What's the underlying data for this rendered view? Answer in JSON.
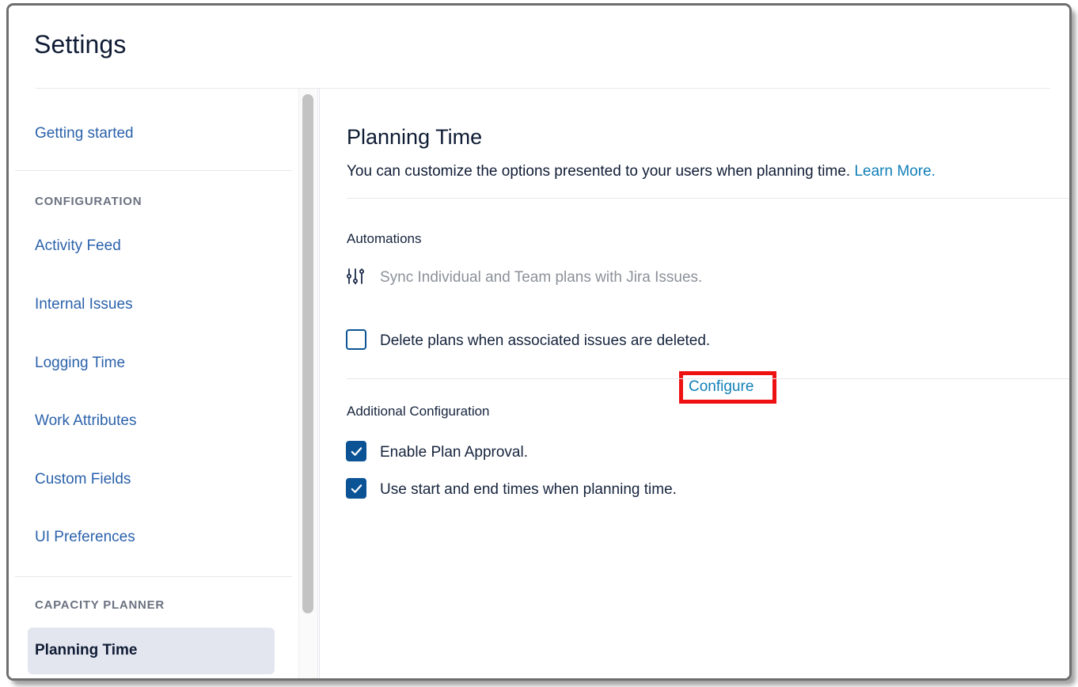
{
  "window": {
    "title": "Settings"
  },
  "sidebar": {
    "top_links": [
      {
        "label": "Getting started",
        "name": "sidebar-item-getting-started"
      }
    ],
    "sections": [
      {
        "heading": "CONFIGURATION",
        "items": [
          {
            "label": "Activity Feed"
          },
          {
            "label": "Internal Issues"
          },
          {
            "label": "Logging Time"
          },
          {
            "label": "Work Attributes"
          },
          {
            "label": "Custom Fields"
          },
          {
            "label": "UI Preferences"
          }
        ]
      },
      {
        "heading": "CAPACITY PLANNER",
        "items": [
          {
            "label": "Planning Time",
            "selected": true
          }
        ]
      }
    ]
  },
  "main": {
    "title": "Planning Time",
    "description": "You can customize the options presented to your users when planning time.",
    "learn_more_label": "Learn More.",
    "automations": {
      "section_label": "Automations",
      "sync_row": {
        "icon": "sliders-icon",
        "text": "Sync Individual and Team plans with Jira Issues.",
        "disabled": true,
        "configure_label": "Configure"
      },
      "delete_row": {
        "text": "Delete plans when associated issues are deleted.",
        "checked": false
      }
    },
    "additional_configuration": {
      "section_label": "Additional Configuration",
      "options": [
        {
          "text": "Enable Plan Approval.",
          "checked": true
        },
        {
          "text": "Use start and end times when planning time.",
          "checked": true
        }
      ]
    }
  },
  "colors": {
    "link_blue": "#2b62ab",
    "accent_cyan": "#1080b8",
    "checkbox_navy": "#0c5396",
    "highlight_red": "#ee1111",
    "selected_pill": "#e3e6ef",
    "heading_gray": "#6b7280"
  }
}
